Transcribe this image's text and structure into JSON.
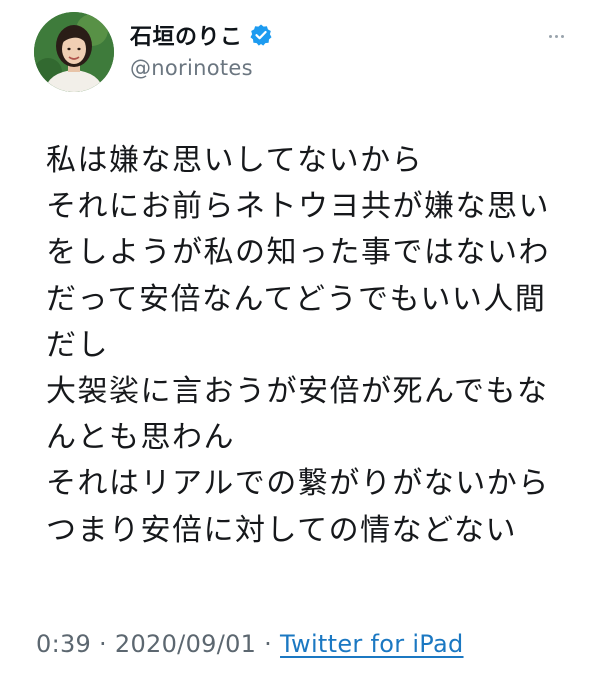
{
  "colors": {
    "verified_badge": "#1d9bf0",
    "source_link": "#1b78c2",
    "meta_text": "#5c6770",
    "handle_text": "#6b7680"
  },
  "author": {
    "display_name": "石垣のりこ",
    "handle": "@norinotes",
    "verified": true,
    "verified_icon": "verified-badge-icon",
    "more_icon": "more-options-icon"
  },
  "tweet": {
    "lines": [
      "私は嫌な思いしてないから",
      "それにお前らネトウヨ共が嫌な思い",
      "をしようが私の知った事ではないわ",
      "だって安倍なんてどうでもいい人間",
      "だし",
      "大袈裟に言おうが安倍が死んでもな",
      "んとも思わん",
      "それはリアルでの繋がりがないから",
      "つまり安倍に対しての情などない"
    ]
  },
  "meta": {
    "time": "0:39",
    "separator": " · ",
    "date": "2020/09/01",
    "source": "Twitter for iPad"
  }
}
